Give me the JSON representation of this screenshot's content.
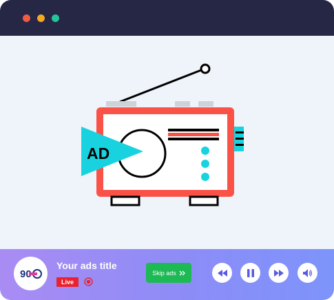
{
  "window": {
    "traffic_lights": [
      "#f15a45",
      "#f7a821",
      "#25c39a"
    ]
  },
  "colors": {
    "titlebar": "#252745",
    "radio_body": "#fb5247",
    "accent_cyan": "#18d3df",
    "skip_green": "#1db954",
    "live_red": "#e8232f",
    "control_icon": "#5a5be0"
  },
  "illustration": {
    "ad_label": "AD"
  },
  "player": {
    "title": "Your ads title",
    "live_label": "Live",
    "skip_label": "Skip ads",
    "controls": [
      "rewind-icon",
      "pause-icon",
      "fast-forward-icon",
      "volume-icon"
    ],
    "logo_icon": "station-logo"
  }
}
